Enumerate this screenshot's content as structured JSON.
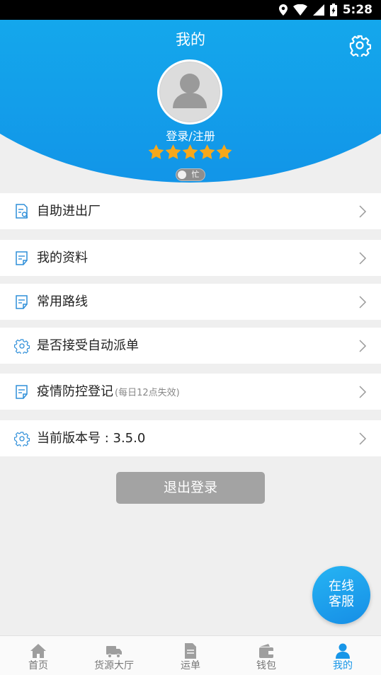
{
  "status_bar": {
    "time": "5:28",
    "icons": [
      "location-icon",
      "wifi-icon",
      "signal-icon",
      "battery-icon"
    ]
  },
  "header": {
    "title": "我的",
    "login_text": "登录/注册",
    "rating_stars": 5,
    "busy_label": "忙",
    "settings_icon": "gear-icon",
    "avatar_icon": "user-placeholder-icon"
  },
  "menu": [
    {
      "label": "自助进出厂",
      "hint": "",
      "icon": "document-search-icon"
    },
    {
      "label": "我的资料",
      "hint": "",
      "icon": "document-icon"
    },
    {
      "label": "常用路线",
      "hint": "",
      "icon": "document-icon"
    },
    {
      "label": "是否接受自动派单",
      "hint": "",
      "icon": "gear-outline-icon"
    },
    {
      "label": "疫情防控登记",
      "hint": "(每日12点失效)",
      "icon": "document-icon"
    },
    {
      "label": "当前版本号 : 3.5.0",
      "hint": "",
      "icon": "gear-outline-icon"
    }
  ],
  "logout_label": "退出登录",
  "service_fab": {
    "line1": "在线",
    "line2": "客服"
  },
  "tabs": [
    {
      "label": "首页",
      "icon": "home-icon",
      "active": false
    },
    {
      "label": "货源大厅",
      "icon": "truck-icon",
      "active": false
    },
    {
      "label": "运单",
      "icon": "waybill-icon",
      "active": false
    },
    {
      "label": "钱包",
      "icon": "wallet-icon",
      "active": false
    },
    {
      "label": "我的",
      "icon": "profile-icon",
      "active": true
    }
  ],
  "colors": {
    "accent": "#1796e8",
    "header_top": "#1fc6f1",
    "star": "#f7a81b",
    "logout_bg": "#a3a3a3"
  }
}
